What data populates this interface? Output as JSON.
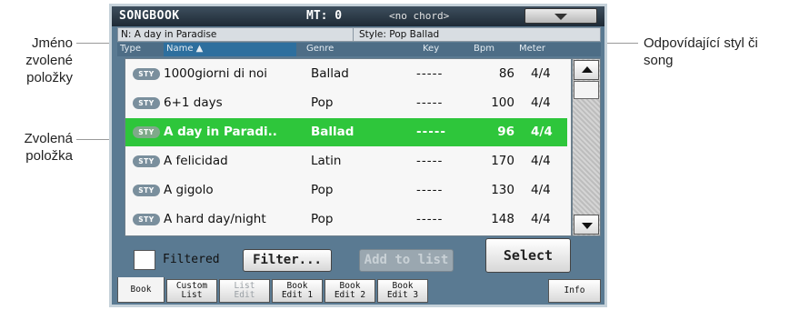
{
  "callouts": {
    "item_name": [
      "Jméno",
      "zvolené",
      "položky"
    ],
    "selected_item": [
      "Zvolená",
      "položka"
    ],
    "matching": [
      "Odpovídající styl či",
      "song"
    ]
  },
  "topbar": {
    "title": "SONGBOOK",
    "mt": "MT: 0",
    "chord": "<no chord>",
    "menu_icon": "chevron-down-icon"
  },
  "info": {
    "name": "N: A day in Paradise",
    "style": "Style: Pop Ballad"
  },
  "columns": {
    "type": "Type",
    "name": "Name ▲",
    "genre": "Genre",
    "key": "Key",
    "bpm": "Bpm",
    "meter": "Meter"
  },
  "badge": "STY",
  "rows": [
    {
      "name": "1000giorni di noi",
      "genre": "Ballad",
      "key": "-----",
      "bpm": "86",
      "meter": "4/4"
    },
    {
      "name": "6+1 days",
      "genre": "Pop",
      "key": "-----",
      "bpm": "100",
      "meter": "4/4"
    },
    {
      "name": "A day in Paradi..",
      "genre": "Ballad",
      "key": "-----",
      "bpm": "96",
      "meter": "4/4",
      "selected": true
    },
    {
      "name": "A felicidad",
      "genre": "Latin",
      "key": "-----",
      "bpm": "170",
      "meter": "4/4"
    },
    {
      "name": "A gigolo",
      "genre": "Pop",
      "key": "-----",
      "bpm": "130",
      "meter": "4/4"
    },
    {
      "name": "A hard day/night",
      "genre": "Pop",
      "key": "-----",
      "bpm": "148",
      "meter": "4/4"
    }
  ],
  "controls": {
    "filtered": "Filtered",
    "filter": "Filter...",
    "add": "Add to list",
    "select": "Select"
  },
  "tabs": {
    "book": "Book",
    "custom_list": [
      "Custom",
      "List"
    ],
    "list_edit": [
      "List",
      "Edit"
    ],
    "book_edit1": [
      "Book",
      "Edit 1"
    ],
    "book_edit2": [
      "Book",
      "Edit 2"
    ],
    "book_edit3": [
      "Book",
      "Edit 3"
    ],
    "info": "Info"
  },
  "colors": {
    "selection": "#2ec63b",
    "screen_bg": "#5a7a92"
  }
}
